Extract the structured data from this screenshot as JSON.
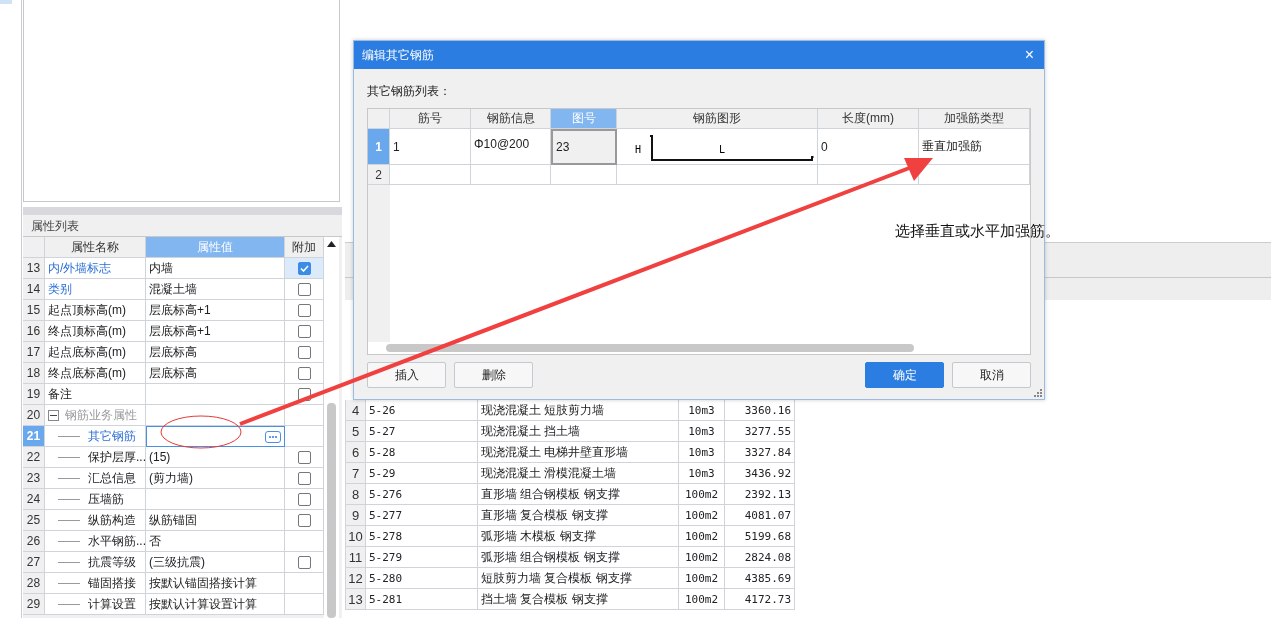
{
  "properties": {
    "title": "属性列表",
    "columns": [
      {
        "label": "属性名称",
        "selected": false
      },
      {
        "label": "属性值",
        "selected": true
      },
      {
        "label": "附加",
        "selected": false
      }
    ],
    "rows": [
      {
        "num": "13",
        "kind": "prop",
        "name": "内/外墙标志",
        "value": "内墙",
        "emphasized": true,
        "checked": true,
        "selected": false
      },
      {
        "num": "14",
        "kind": "prop",
        "name": "类别",
        "value": "混凝土墙",
        "emphasized": true,
        "checked": false,
        "selected": false
      },
      {
        "num": "15",
        "kind": "prop",
        "name": "起点顶标高(m)",
        "value": "层底标高+1",
        "emphasized": false,
        "checked": false,
        "selected": false
      },
      {
        "num": "16",
        "kind": "prop",
        "name": "终点顶标高(m)",
        "value": "层底标高+1",
        "emphasized": false,
        "checked": false,
        "selected": false
      },
      {
        "num": "17",
        "kind": "prop",
        "name": "起点底标高(m)",
        "value": "层底标高",
        "emphasized": false,
        "checked": false,
        "selected": false
      },
      {
        "num": "18",
        "kind": "prop",
        "name": "终点底标高(m)",
        "value": "层底标高",
        "emphasized": false,
        "checked": false,
        "selected": false
      },
      {
        "num": "19",
        "kind": "prop",
        "name": "备注",
        "emphasized": false,
        "checked": false,
        "selected": false
      },
      {
        "num": "20",
        "kind": "group",
        "name": "钢筋业务属性",
        "expanded": true,
        "selected": false
      },
      {
        "num": "21",
        "kind": "child",
        "name": "其它钢筋",
        "emphasized": true,
        "selected": true
      },
      {
        "num": "22",
        "kind": "child",
        "name": "保护层厚...",
        "value": "(15)",
        "emphasized": false,
        "checked": false,
        "selected": false
      },
      {
        "num": "23",
        "kind": "child",
        "name": "汇总信息",
        "value": "(剪力墙)",
        "emphasized": false,
        "checked": false,
        "selected": false
      },
      {
        "num": "24",
        "kind": "child",
        "name": "压墙筋",
        "emphasized": false,
        "checked": false,
        "selected": false
      },
      {
        "num": "25",
        "kind": "child",
        "name": "纵筋构造",
        "value": "纵筋锚固",
        "emphasized": false,
        "checked": false,
        "selected": false
      },
      {
        "num": "26",
        "kind": "child",
        "name": "水平钢筋...",
        "value": "否",
        "emphasized": false,
        "selected": false
      },
      {
        "num": "27",
        "kind": "child",
        "name": "抗震等级",
        "value": "(三级抗震)",
        "emphasized": false,
        "checked": false,
        "selected": false
      },
      {
        "num": "28",
        "kind": "child",
        "name": "锚固搭接",
        "value": "按默认锚固搭接计算",
        "emphasized": false,
        "selected": false
      },
      {
        "num": "29",
        "kind": "child",
        "name": "计算设置",
        "value": "按默认计算设置计算",
        "emphasized": false,
        "selected": false
      }
    ]
  },
  "quota_table": {
    "rows": [
      {
        "num": "4",
        "code": "5-26",
        "name": "现浇混凝土 短肢剪力墙",
        "unit": "10m3",
        "price": "3360.16"
      },
      {
        "num": "5",
        "code": "5-27",
        "name": "现浇混凝土 挡土墙",
        "unit": "10m3",
        "price": "3277.55"
      },
      {
        "num": "6",
        "code": "5-28",
        "name": "现浇混凝土 电梯井壁直形墙",
        "unit": "10m3",
        "price": "3327.84"
      },
      {
        "num": "7",
        "code": "5-29",
        "name": "现浇混凝土 滑模混凝土墙",
        "unit": "10m3",
        "price": "3436.92"
      },
      {
        "num": "8",
        "code": "5-276",
        "name": "直形墙 组合钢模板 钢支撑",
        "unit": "100m2",
        "price": "2392.13"
      },
      {
        "num": "9",
        "code": "5-277",
        "name": "直形墙 复合模板 钢支撑",
        "unit": "100m2",
        "price": "4081.07"
      },
      {
        "num": "10",
        "code": "5-278",
        "name": "弧形墙 木模板 钢支撑",
        "unit": "100m2",
        "price": "5199.68"
      },
      {
        "num": "11",
        "code": "5-279",
        "name": "弧形墙 组合钢模板 钢支撑",
        "unit": "100m2",
        "price": "2824.08"
      },
      {
        "num": "12",
        "code": "5-280",
        "name": "短肢剪力墙 复合模板 钢支撑",
        "unit": "100m2",
        "price": "4385.69"
      },
      {
        "num": "13",
        "code": "5-281",
        "name": "挡土墙 复合模板 钢支撑",
        "unit": "100m2",
        "price": "4172.73"
      }
    ]
  },
  "dialog": {
    "title": "编辑其它钢筋",
    "close": "×",
    "list_label": "其它钢筋列表：",
    "columns": [
      {
        "label": "筋号",
        "selected": false
      },
      {
        "label": "钢筋信息",
        "selected": false
      },
      {
        "label": "图号",
        "selected": true
      },
      {
        "label": "钢筋图形",
        "selected": false
      },
      {
        "label": "长度(mm)",
        "selected": false
      },
      {
        "label": "加强筋类型",
        "selected": false
      }
    ],
    "rows": [
      {
        "num": "1",
        "selected": true,
        "bar_no": "1",
        "info": "Φ10@200",
        "figure_no": "23",
        "shape_labels": [
          "H",
          "L"
        ],
        "length": "0",
        "type": "垂直加强筋"
      },
      {
        "num": "2",
        "selected": false
      }
    ],
    "buttons": [
      {
        "label": "插入",
        "kind": "default"
      },
      {
        "label": "删除",
        "kind": "default"
      },
      {
        "label": "确定",
        "kind": "primary"
      },
      {
        "label": "取消",
        "kind": "default"
      }
    ]
  },
  "annotation": {
    "text": "选择垂直或水平加强筋。"
  }
}
